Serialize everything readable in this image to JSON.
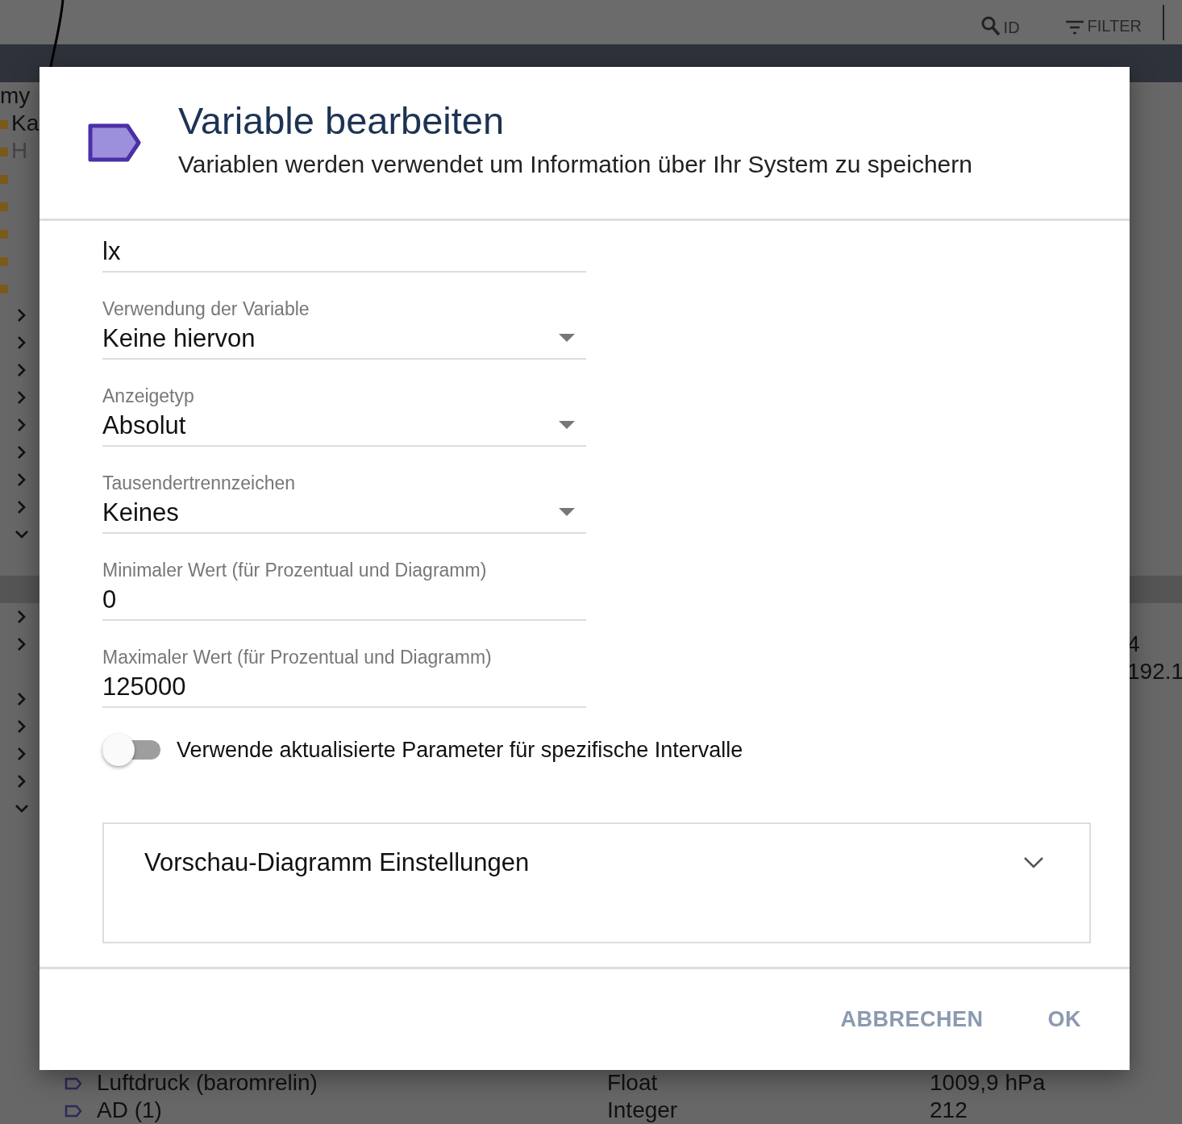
{
  "toolbar": {
    "search": {
      "label": "ID"
    },
    "filter": {
      "label": "FILTER"
    }
  },
  "table": {
    "rows": [
      {
        "kind": "label",
        "name": "my"
      },
      {
        "kind": "folder",
        "name": "Ka"
      },
      {
        "kind": "folder",
        "name": "H",
        "disabled": true
      },
      {
        "kind": "folder"
      },
      {
        "kind": "folder"
      },
      {
        "kind": "folder"
      },
      {
        "kind": "folder"
      },
      {
        "kind": "folder"
      },
      {
        "kind": "group",
        "expanded": false
      },
      {
        "kind": "group",
        "expanded": false
      },
      {
        "kind": "group",
        "expanded": false
      },
      {
        "kind": "group",
        "expanded": false
      },
      {
        "kind": "group",
        "expanded": false
      },
      {
        "kind": "group",
        "expanded": false
      },
      {
        "kind": "group",
        "expanded": false
      },
      {
        "kind": "group",
        "expanded": false
      },
      {
        "kind": "group",
        "expanded": true
      },
      {
        "kind": "spacer"
      },
      {
        "kind": "band"
      },
      {
        "kind": "group",
        "expanded": false
      },
      {
        "kind": "group",
        "expanded": false,
        "extra": "4"
      },
      {
        "kind": "spacer",
        "extra": "192.1"
      },
      {
        "kind": "group",
        "expanded": false
      },
      {
        "kind": "group",
        "expanded": false
      },
      {
        "kind": "group",
        "expanded": false
      },
      {
        "kind": "group",
        "expanded": false
      },
      {
        "kind": "group",
        "expanded": true
      },
      {
        "kind": "spacer"
      },
      {
        "kind": "spacer"
      },
      {
        "kind": "spacer"
      },
      {
        "kind": "spacer"
      },
      {
        "kind": "spacer"
      },
      {
        "kind": "spacer"
      },
      {
        "kind": "spacer"
      },
      {
        "kind": "spacer"
      },
      {
        "kind": "spacer"
      },
      {
        "kind": "variable",
        "name": "Luftdruck (baromrelin)",
        "type": "Float",
        "value": "1009,9 hPa"
      },
      {
        "kind": "variable",
        "name": "AD (1)",
        "type": "Integer",
        "value": "212"
      }
    ]
  },
  "dialog": {
    "title": "Variable bearbeiten",
    "subtitle": "Variablen werden verwendet um Information über Ihr System zu speichern",
    "fields": [
      {
        "kind": "text",
        "value": "lx"
      },
      {
        "kind": "select",
        "label": "Verwendung der Variable",
        "value": "Keine hiervon"
      },
      {
        "kind": "select",
        "label": "Anzeigetyp",
        "value": "Absolut"
      },
      {
        "kind": "select",
        "label": "Tausendertrennzeichen",
        "value": "Keines"
      },
      {
        "kind": "text",
        "label": "Minimaler Wert (für Prozentual und Diagramm)",
        "value": "0"
      },
      {
        "kind": "text",
        "label": "Maximaler Wert (für Prozentual und Diagramm)",
        "value": "125000"
      }
    ],
    "toggle": {
      "label": "Verwende aktualisierte Parameter für spezifische Intervalle",
      "on": false
    },
    "accordion": {
      "title": "Vorschau-Diagramm Einstellungen",
      "expanded": false
    },
    "buttons": [
      "ABBRECHEN",
      "OK"
    ]
  }
}
